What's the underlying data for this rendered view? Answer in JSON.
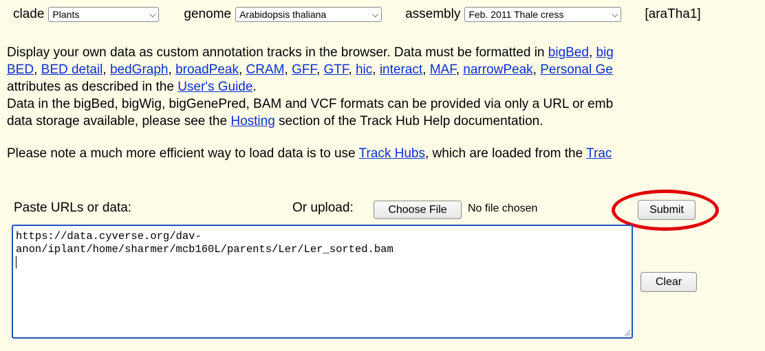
{
  "selectors": {
    "clade": {
      "label": "clade",
      "value": "Plants"
    },
    "genome": {
      "label": "genome",
      "value": "Arabidopsis thaliana"
    },
    "assembly": {
      "label": "assembly",
      "value": "Feb. 2011 Thale cress"
    },
    "db": "[araTha1]"
  },
  "intro": {
    "line1_prefix": "Display your own data as custom annotation tracks in the browser. Data must be formatted in ",
    "line1_links": [
      "bigBed",
      "big"
    ],
    "line2_links": [
      "BED",
      "BED detail",
      "bedGraph",
      "broadPeak",
      "CRAM",
      "GFF",
      "GTF",
      "hic",
      "interact",
      "MAF",
      "narrowPeak",
      "Personal Ge"
    ],
    "line3_prefix": "attributes as described in the ",
    "line3_link": "User's Guide",
    "line3_suffix": ".",
    "line4": "Data in the bigBed, bigWig, bigGenePred, BAM and VCF formats can be provided via only a URL or emb",
    "line5_prefix": "data storage available, please see the ",
    "line5_link": "Hosting",
    "line5_suffix": " section of the Track Hub Help documentation.",
    "line6_prefix": "Please note a much more efficient way to load data is to use ",
    "line6_link": "Track Hubs",
    "line6_mid": ", which are loaded from the ",
    "line6_link2": "Trac"
  },
  "form": {
    "paste_label": "Paste URLs or data:",
    "upload_label": "Or upload:",
    "choose_file": "Choose File",
    "no_file": "No file chosen",
    "submit": "Submit",
    "clear": "Clear",
    "textarea_line1": "https://data.cyverse.org/dav-",
    "textarea_line2": "anon/iplant/home/sharmer/mcb160L/parents/Ler/Ler_sorted.bam"
  },
  "colors": {
    "background": "#fffde8",
    "link": "#0a2fd1",
    "highlight": "#e00000",
    "focus_border": "#1f4fc4"
  }
}
